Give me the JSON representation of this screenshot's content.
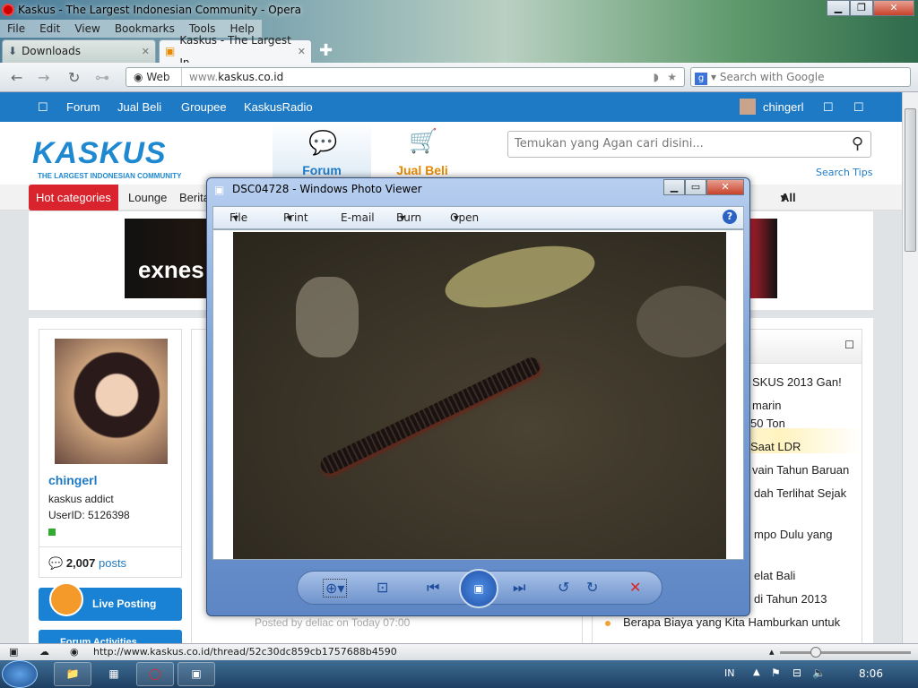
{
  "window": {
    "title": "Kaskus - The Largest Indonesian Community - Opera",
    "min": "▁",
    "max": "❐",
    "close": "✕"
  },
  "menu": [
    "File",
    "Edit",
    "View",
    "Bookmarks",
    "Tools",
    "Help"
  ],
  "tabs": [
    {
      "label": "Downloads"
    },
    {
      "label": "Kaskus - The Largest In..."
    }
  ],
  "addressbar": {
    "web_label": "Web",
    "url_prefix": "www.",
    "url_domain": "kaskus.co.id",
    "search_placeholder": "Search with Google"
  },
  "kaskus": {
    "nav": [
      "Forum",
      "Jual Beli",
      "Groupee",
      "KaskusRadio"
    ],
    "username": "chingerl",
    "logo_text": "KASKUS",
    "logo_tagline": "THE LARGEST INDONESIAN COMMUNITY",
    "header_tabs": [
      "Forum",
      "Jual Beli"
    ],
    "search_placeholder": "Temukan yang Agan cari disini...",
    "search_tips": "Search Tips",
    "categories": {
      "hot": "Hot categories",
      "items": [
        "Lounge",
        "Berita"
      ],
      "all": "All categories"
    },
    "banner_text": "exnes",
    "profile": {
      "name": "chingerl",
      "rank": "kaskus addict",
      "userid": "UserID: 5126398",
      "posts_count": "2,007",
      "posts_label": "posts"
    },
    "live_posting": "Live Posting",
    "forum_activities": "Forum Activities",
    "posted_by": "Posted by deliac on Today 07:00",
    "right_list": [
      "SKUS 2013 Gan!",
      "marin",
      "50 Ton",
      "Saat LDR",
      "vain Tahun Baruan",
      "dah Terlihat Sejak",
      "mpo Dulu yang",
      "elat Bali",
      "di Tahun 2013",
      "Berapa Biaya yang Kita Hamburkan untuk"
    ]
  },
  "photo_viewer": {
    "title": "DSC04728 - Windows Photo Viewer",
    "menu": [
      "File",
      "Print",
      "E-mail",
      "Burn",
      "Open"
    ]
  },
  "status": {
    "url": "http://www.kaskus.co.id/thread/52c30dc859cb1757688b4590"
  },
  "taskbar": {
    "lang": "IN",
    "time": "8:06"
  },
  "colors": {
    "kaskus_blue": "#1e7ac4",
    "hot_red": "#d9232d",
    "jual_beli_orange": "#e88a00"
  }
}
